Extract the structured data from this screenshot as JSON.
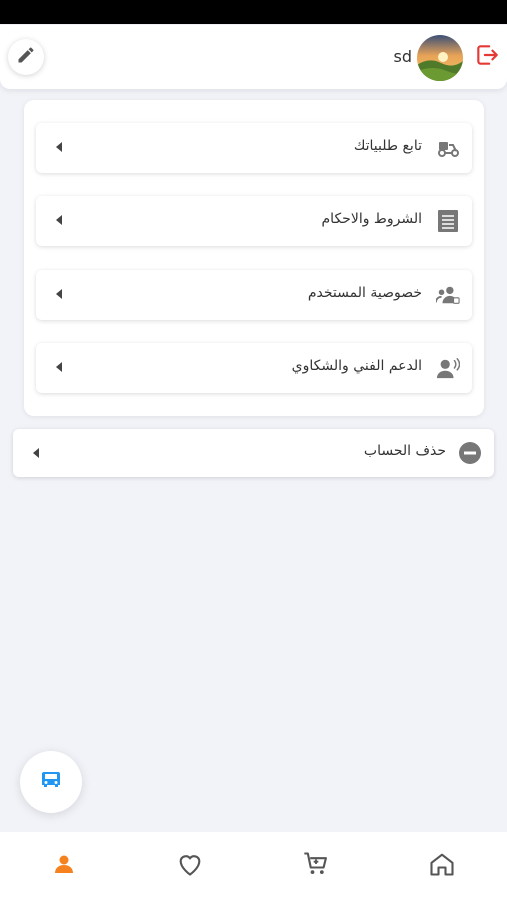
{
  "header": {
    "username": "sd",
    "accent_color": "#e53935"
  },
  "menu": {
    "items": [
      {
        "label": "تابع طلبياتك",
        "icon": "scooter-icon"
      },
      {
        "label": "الشروط والاحكام",
        "icon": "document-list-icon"
      },
      {
        "label": "خصوصية المستخدم",
        "icon": "user-privacy-icon"
      },
      {
        "label": "الدعم الفني والشكاوي",
        "icon": "support-voice-icon"
      }
    ]
  },
  "delete_account": {
    "label": "حذف الحساب",
    "icon": "minus-circle-icon"
  },
  "fab": {
    "icon": "vehicle-icon",
    "color": "#2196f3"
  },
  "bottom_nav": {
    "items": [
      {
        "name": "profile",
        "icon": "person-icon",
        "active": true
      },
      {
        "name": "favorites",
        "icon": "heart-icon",
        "active": false
      },
      {
        "name": "cart",
        "icon": "cart-icon",
        "active": false
      },
      {
        "name": "home",
        "icon": "home-icon",
        "active": false
      }
    ],
    "active_color": "#f5821f",
    "inactive_color": "#555555"
  }
}
